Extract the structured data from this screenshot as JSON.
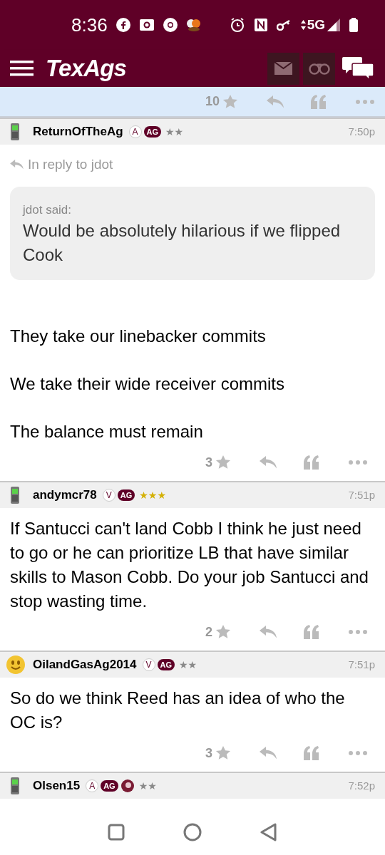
{
  "status_bar": {
    "time": "8:36",
    "network": "5G"
  },
  "app_bar": {
    "logo": "TexAgs"
  },
  "previous_post_actions": {
    "likes": "10"
  },
  "posts": [
    {
      "author": "ReturnOfTheAg",
      "avatar": {
        "kind": "phone"
      },
      "badges": [
        {
          "kind": "letter",
          "text": "A"
        },
        {
          "kind": "ag",
          "text": "AG"
        }
      ],
      "rank": "★★",
      "rank_gold": false,
      "time": "7:50p",
      "reply_to": "In reply to jdot",
      "quote": {
        "author": "jdot said:",
        "text": "Would be absolutely hilarious if we flipped Cook"
      },
      "paragraphs": [
        "They take our linebacker commits",
        "We take their wide receiver commits",
        "The balance must remain"
      ],
      "likes": "3"
    },
    {
      "author": "andymcr78",
      "avatar": {
        "kind": "phone"
      },
      "badges": [
        {
          "kind": "letter",
          "text": "V"
        },
        {
          "kind": "ag",
          "text": "AG"
        }
      ],
      "rank": "★★★",
      "rank_gold": true,
      "time": "7:51p",
      "paragraphs": [
        "If Santucci can't land Cobb I think he just need to go or he can prioritize LB that have similar skills to Mason Cobb. Do your job Santucci and stop wasting time."
      ],
      "likes": "2"
    },
    {
      "author": "OilandGasAg2014",
      "avatar": {
        "kind": "smiley"
      },
      "badges": [
        {
          "kind": "letter",
          "text": "V"
        },
        {
          "kind": "ag",
          "text": "AG"
        }
      ],
      "rank": "★★",
      "rank_gold": false,
      "time": "7:51p",
      "paragraphs": [
        "So do we think Reed has an idea of who the OC is?"
      ],
      "likes": "3"
    },
    {
      "author": "Olsen15",
      "avatar": {
        "kind": "phone"
      },
      "badges": [
        {
          "kind": "letter",
          "text": "A"
        },
        {
          "kind": "ag",
          "text": "AG"
        },
        {
          "kind": "emblem"
        }
      ],
      "rank": "★★",
      "rank_gold": false,
      "time": "7:52p"
    }
  ]
}
